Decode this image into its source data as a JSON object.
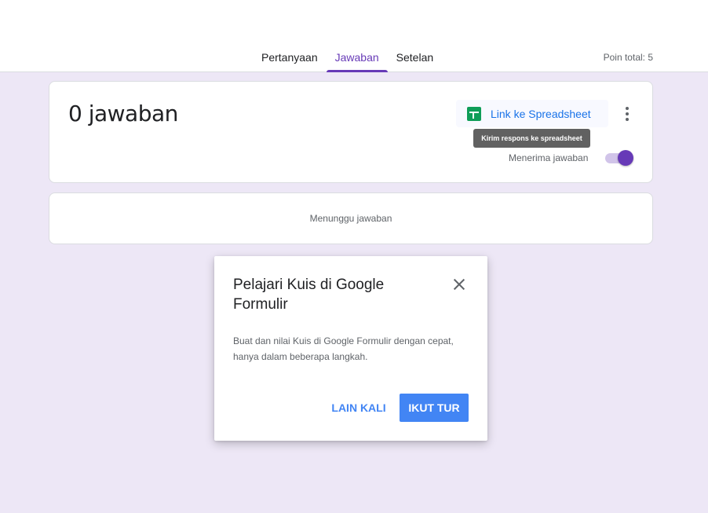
{
  "header": {
    "tabs": [
      {
        "label": "Pertanyaan",
        "active": false
      },
      {
        "label": "Jawaban",
        "active": true
      },
      {
        "label": "Setelan",
        "active": false
      }
    ],
    "points_total": "Poin total: 5",
    "accent_color": "#673ab7"
  },
  "responses": {
    "count_label": "0 jawaban",
    "spreadsheet_button": "Link ke Spreadsheet",
    "spreadsheet_icon": "google-sheets-icon",
    "more_icon": "more-vert-icon",
    "tooltip": "Kirim respons ke spreadsheet",
    "accepting_label": "Menerima jawaban",
    "accepting_on": true
  },
  "waiting": {
    "text": "Menunggu jawaban"
  },
  "dialog": {
    "title": "Pelajari Kuis di Google Formulir",
    "body": "Buat dan nilai Kuis di Google Formulir dengan cepat, hanya dalam beberapa langkah.",
    "later_button": "LAIN KALI",
    "tour_button": "IKUT TUR",
    "close_icon": "close-icon"
  },
  "colors": {
    "background": "#ede7f6",
    "primary_button": "#4285f4",
    "sheets_green": "#0f9d58",
    "link_blue": "#1a73e8"
  }
}
